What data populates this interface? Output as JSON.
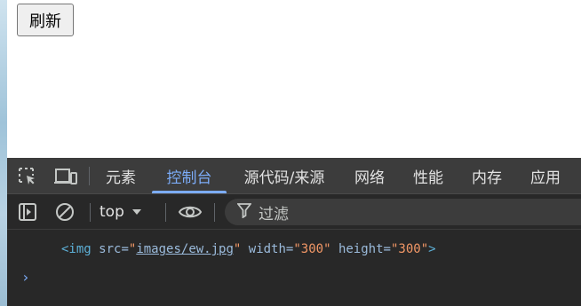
{
  "page": {
    "refresh_label": "刷新"
  },
  "devtools": {
    "tabs": [
      {
        "label": "元素",
        "active": false
      },
      {
        "label": "控制台",
        "active": true
      },
      {
        "label": "源代码/来源",
        "active": false
      },
      {
        "label": "网络",
        "active": false
      },
      {
        "label": "性能",
        "active": false
      },
      {
        "label": "内存",
        "active": false
      },
      {
        "label": "应用",
        "active": false
      }
    ],
    "context": "top",
    "filter_placeholder": "过滤",
    "accent_color": "#7cacf8",
    "icons": [
      "inspect-element-icon",
      "device-toolbar-icon",
      "sidebar-toggle-icon",
      "clear-console-icon",
      "dropdown-arrow-icon",
      "live-expression-eye-icon",
      "filter-funnel-icon"
    ]
  },
  "console": {
    "log": {
      "tag_open": "<img",
      "attr1_name": "src=",
      "attr1_value": "images/ew.jpg",
      "attr2_name": "width=",
      "attr2_value": "300",
      "attr3_name": "height=",
      "attr3_value": "300",
      "tag_close": ">"
    },
    "prompt_symbol": "›"
  }
}
